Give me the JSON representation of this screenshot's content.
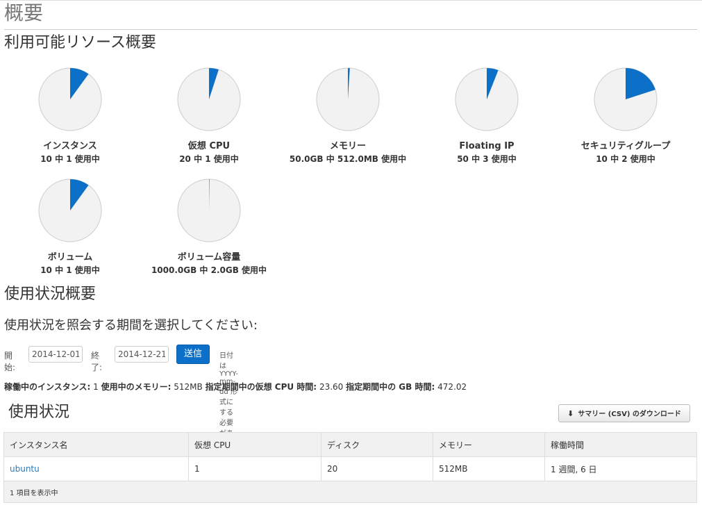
{
  "page": {
    "title": "概要"
  },
  "quota_section": {
    "heading": "利用可能リソース概要",
    "items": [
      {
        "name": "インスタンス",
        "used_text": "10 中 1 使用中",
        "fraction": 0.1
      },
      {
        "name": "仮想 CPU",
        "used_text": "20 中 1 使用中",
        "fraction": 0.05
      },
      {
        "name": "メモリー",
        "used_text": "50.0GB 中 512.0MB 使用中",
        "fraction": 0.01
      },
      {
        "name": "Floating IP",
        "used_text": "50 中 3 使用中",
        "fraction": 0.06
      },
      {
        "name": "セキュリティグループ",
        "used_text": "10 中 2 使用中",
        "fraction": 0.2
      },
      {
        "name": "ボリューム",
        "used_text": "10 中 1 使用中",
        "fraction": 0.1
      },
      {
        "name": "ボリューム容量",
        "used_text": "1000.0GB 中 2.0GB 使用中",
        "fraction": 0.002
      }
    ],
    "colors": {
      "used": "#0c6fc8",
      "free": "#f2f2f2",
      "border": "#cccccc"
    }
  },
  "usage_summary": {
    "heading": "使用状況概要",
    "period_heading": "使用状況を照会する期間を選択してください:",
    "start_label": "開始:",
    "start_value": "2014-12-01",
    "end_label": "終了:",
    "end_value": "2014-12-21",
    "submit_label": "送信",
    "hint": "日付は YYYY-mm-dd 形式にする必要があります。",
    "stats": [
      {
        "label": "稼働中のインスタンス:",
        "value": "1"
      },
      {
        "label": "使用中のメモリー:",
        "value": "512MB"
      },
      {
        "label": "指定期間中の仮想 CPU 時間:",
        "value": "23.60"
      },
      {
        "label": "指定期間中の GB 時間:",
        "value": "472.02"
      }
    ]
  },
  "usage": {
    "heading": "使用状況",
    "download_label": "サマリー (CSV) のダウンロード",
    "download_icon": "download-icon",
    "columns": [
      "インスタンス名",
      "仮想 CPU",
      "ディスク",
      "メモリー",
      "稼働時間"
    ],
    "rows": [
      {
        "name": "ubuntu",
        "vcpu": "1",
        "disk": "20",
        "memory": "512MB",
        "uptime": "1 週間, 6 日"
      }
    ],
    "footer": "1 項目を表示中"
  }
}
